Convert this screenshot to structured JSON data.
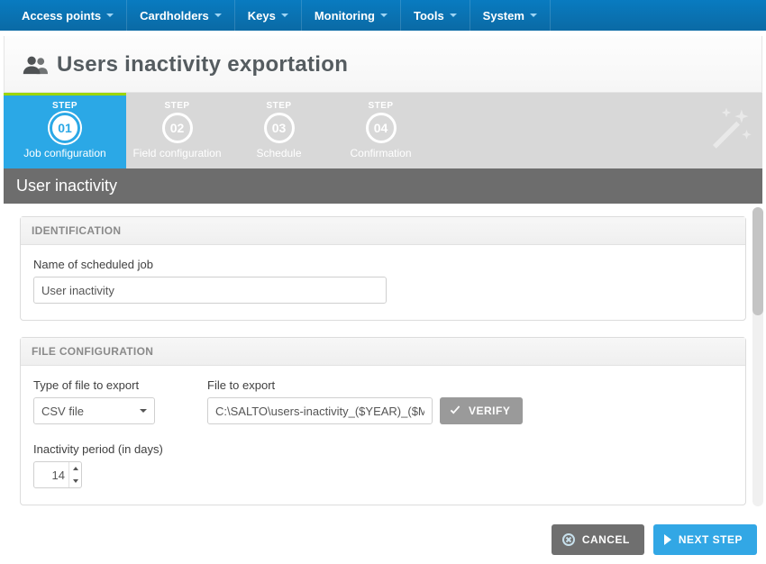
{
  "nav": {
    "items": [
      {
        "label": "Access points"
      },
      {
        "label": "Cardholders"
      },
      {
        "label": "Keys"
      },
      {
        "label": "Monitoring"
      },
      {
        "label": "Tools"
      },
      {
        "label": "System"
      }
    ]
  },
  "page": {
    "title": "Users inactivity exportation",
    "section": "User inactivity"
  },
  "wizard": {
    "eyebrow": "STEP",
    "steps": [
      {
        "number": "01",
        "label": "Job configuration"
      },
      {
        "number": "02",
        "label": "Field configuration"
      },
      {
        "number": "03",
        "label": "Schedule"
      },
      {
        "number": "04",
        "label": "Confirmation"
      }
    ],
    "active_index": 0
  },
  "identification": {
    "panel_title": "IDENTIFICATION",
    "name_label": "Name of scheduled job",
    "name_value": "User inactivity"
  },
  "file_config": {
    "panel_title": "FILE CONFIGURATION",
    "type_label": "Type of file to export",
    "type_value": "CSV file",
    "file_label": "File to export",
    "file_value": "C:\\SALTO\\users-inactivity_($YEAR)_($MONTH)_($D",
    "verify_label": "VERIFY",
    "inactivity_label": "Inactivity period (in days)",
    "inactivity_value": "14"
  },
  "footer": {
    "cancel_label": "CANCEL",
    "next_label": "NEXT STEP"
  }
}
